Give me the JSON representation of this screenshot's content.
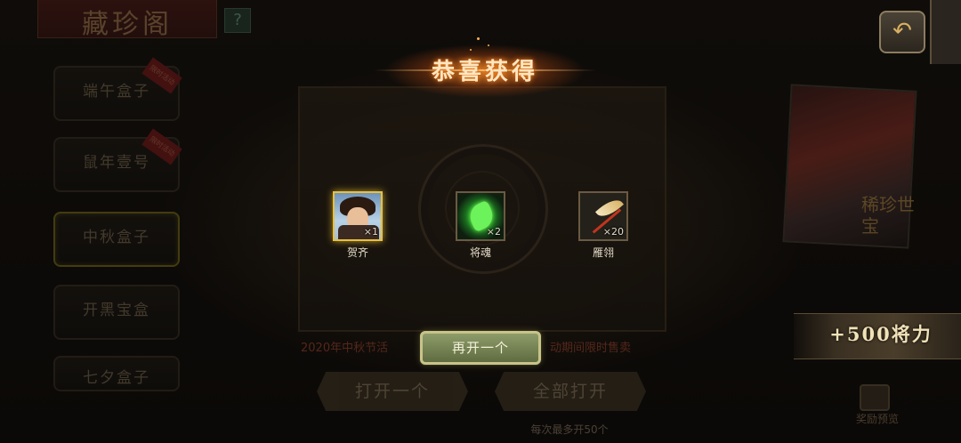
{
  "screen": {
    "title": "藏珍阁",
    "help": "?"
  },
  "side_tabs": [
    {
      "label": "端午盒子",
      "sub": "",
      "badge": "限时活动",
      "active": false
    },
    {
      "label": "鼠年壹号",
      "sub": "",
      "badge": "限时活动",
      "active": false
    },
    {
      "label": "中秋盒子",
      "sub": "",
      "badge": "",
      "active": true
    },
    {
      "label": "开黑宝盒",
      "sub": "",
      "badge": "",
      "active": false
    },
    {
      "label": "七夕盒子",
      "sub": "",
      "badge": "",
      "active": false
    }
  ],
  "reward_popup": {
    "header": "恭喜获得",
    "items": [
      {
        "name": "贺齐",
        "count": "×1",
        "icon": "hero-portrait-icon"
      },
      {
        "name": "将魂",
        "count": "×2",
        "icon": "jade-soul-icon"
      },
      {
        "name": "雁翎",
        "count": "×20",
        "icon": "feather-icon"
      }
    ],
    "reopen_label": "再开一个"
  },
  "background_panel": {
    "promo_left": "2020年中秋节活",
    "promo_right": "动期间限时售卖",
    "open_one_label": "打开一个",
    "open_all_label": "全部打开",
    "tip": "每次最多开50个"
  },
  "right_panel": {
    "poster_text": "稀珍世宝",
    "power_text": "+500将力",
    "preview_label": "奖励预览"
  },
  "colors": {
    "gold_frame": "#e8c040",
    "reopen_button": "#7a8654",
    "header_glow": "#ff8a20"
  }
}
